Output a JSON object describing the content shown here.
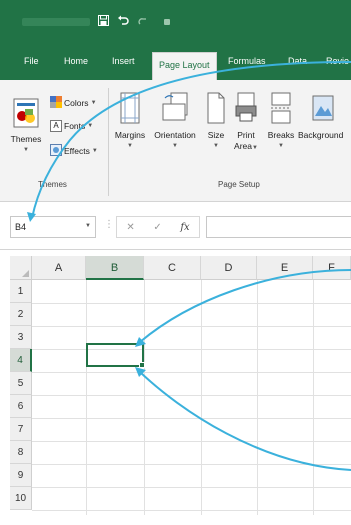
{
  "app": {
    "accent": "#217346",
    "annotation_color": "#3bb1dc"
  },
  "quick_access": {
    "save_icon": "save-icon",
    "undo_icon": "undo-icon",
    "redo_icon": "redo-icon"
  },
  "tabs": [
    {
      "label": "File"
    },
    {
      "label": "Home"
    },
    {
      "label": "Insert"
    },
    {
      "label": "Page Layout",
      "active": true
    },
    {
      "label": "Formulas"
    },
    {
      "label": "Data"
    },
    {
      "label": "Revie"
    }
  ],
  "ribbon": {
    "themes_group": {
      "label": "Themes",
      "themes_button": "Themes",
      "colors": "Colors",
      "fonts": "Fonts",
      "effects": "Effects"
    },
    "page_setup_group": {
      "label": "Page Setup",
      "margins": "Margins",
      "orientation": "Orientation",
      "size": "Size",
      "print_area_line1": "Print",
      "print_area_line2": "Area",
      "breaks": "Breaks",
      "background": "Background"
    }
  },
  "formula_bar": {
    "name_box": "B4",
    "cancel_glyph": "✕",
    "enter_glyph": "✓",
    "fx_label": "fx",
    "formula_value": ""
  },
  "grid": {
    "columns": [
      "A",
      "B",
      "C",
      "D",
      "E",
      "F"
    ],
    "rows": [
      "1",
      "2",
      "3",
      "4",
      "5",
      "6",
      "7",
      "8",
      "9",
      "10"
    ],
    "selected_column": "B",
    "selected_row": "4"
  }
}
